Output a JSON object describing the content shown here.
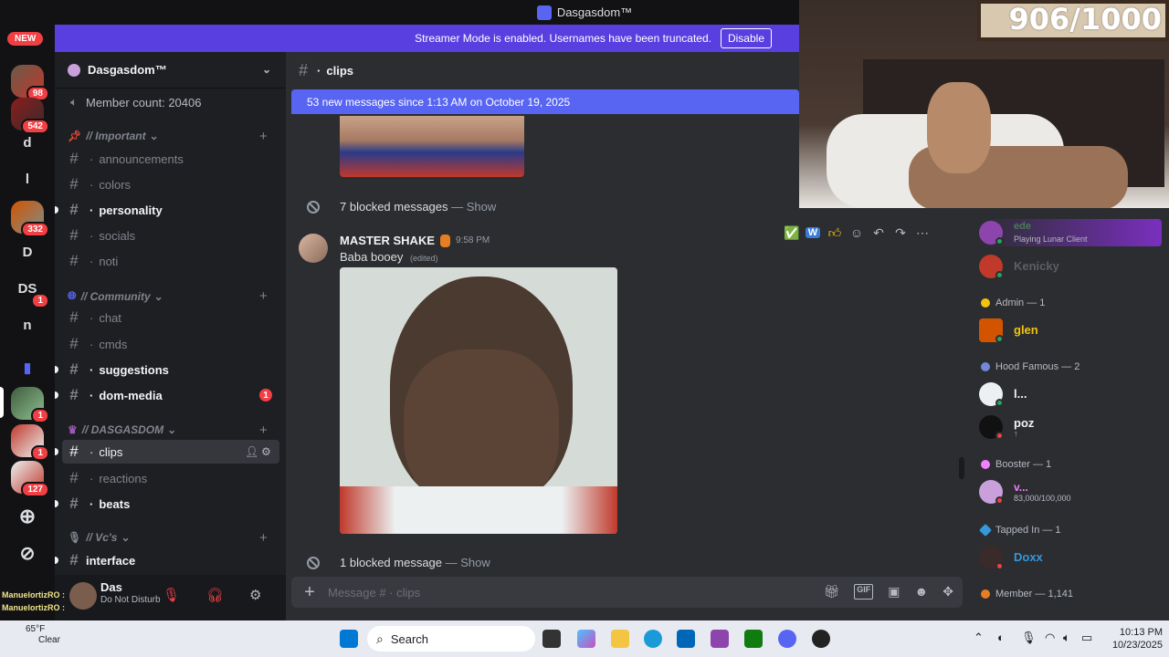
{
  "window": {
    "title": "Dasgasdom™"
  },
  "banner": {
    "text": "Streamer Mode is enabled. Usernames have been truncated.",
    "button": "Disable"
  },
  "rail": {
    "new_label": "NEW",
    "servers": [
      {
        "label": "",
        "badge": "98"
      },
      {
        "label": "",
        "badge": "542"
      },
      {
        "label": "d",
        "badge": ""
      },
      {
        "label": "l",
        "badge": ""
      },
      {
        "label": "",
        "badge": "332"
      },
      {
        "label": "D",
        "badge": ""
      },
      {
        "label": "DS",
        "badge": "1"
      },
      {
        "label": "n",
        "badge": ""
      },
      {
        "label": "",
        "badge": "1"
      },
      {
        "label": "",
        "badge": "1"
      },
      {
        "label": "",
        "badge": "127"
      }
    ]
  },
  "server": {
    "name": "Dasgasdom™",
    "member_count": "Member count: 20406",
    "categories": {
      "important": "// Important",
      "community": "// Community",
      "dasgasdom": "// DASGASDOM",
      "vcs": "// Vc's"
    },
    "channels": {
      "announcements": "announcements",
      "colors": "colors",
      "personality": "personality",
      "socials": "socials",
      "noti": "noti",
      "chat": "chat",
      "cmds": "cmds",
      "suggestions": "suggestions",
      "dom_media": "dom-media",
      "dom_media_badge": "1",
      "clips": "clips",
      "reactions": "reactions",
      "beats": "beats",
      "interface": "interface"
    }
  },
  "user": {
    "name": "Das",
    "status": "Do Not Disturb",
    "overlay_lines": [
      "ManuelortizRO :",
      "ManuelortizRO :"
    ]
  },
  "chat": {
    "channel": "clips",
    "new_messages": "53 new messages since 1:13 AM on October 19, 2025",
    "blocked_top": "7 blocked messages",
    "blocked_bottom": "1 blocked message",
    "show_label": "— Show",
    "message": {
      "author": "MASTER SHAKE",
      "time": "9:58 PM",
      "text": "Baba booey",
      "edited": "(edited)"
    },
    "composer_placeholder": "Message # · clips"
  },
  "members": {
    "top": [
      {
        "name": "ede",
        "sub": "Playing Lunar Client",
        "color": "#4a7a5a"
      },
      {
        "name": "Kenicky",
        "sub": "",
        "color": "#949ba4"
      }
    ],
    "groups": [
      {
        "label": "Admin — 1",
        "members": [
          {
            "name": "glen",
            "sub": "",
            "color": "#f1c40f"
          }
        ]
      },
      {
        "label": "Hood Famous — 2",
        "members": [
          {
            "name": "l...",
            "sub": "",
            "color": "#f2f3f5"
          },
          {
            "name": "poz",
            "sub": "↑",
            "color": "#f2f3f5"
          }
        ]
      },
      {
        "label": "Booster — 1",
        "members": [
          {
            "name": "v...",
            "sub": "83,000/100,000",
            "color": "#f47fff"
          }
        ]
      },
      {
        "label": "Tapped In — 1",
        "members": [
          {
            "name": "Doxx",
            "sub": "",
            "color": "#3498db"
          }
        ]
      },
      {
        "label": "Member — 1,141",
        "members": []
      }
    ]
  },
  "webcam": {
    "counter": "906/1000"
  },
  "taskbar": {
    "search": "Search",
    "time": "10:13 PM",
    "date": "10/23/2025",
    "weather_temp": "65°F",
    "weather_desc": "Clear"
  },
  "colors": {
    "accent": "#5865f2",
    "banner": "#5a3fe0",
    "danger": "#f23f43"
  }
}
